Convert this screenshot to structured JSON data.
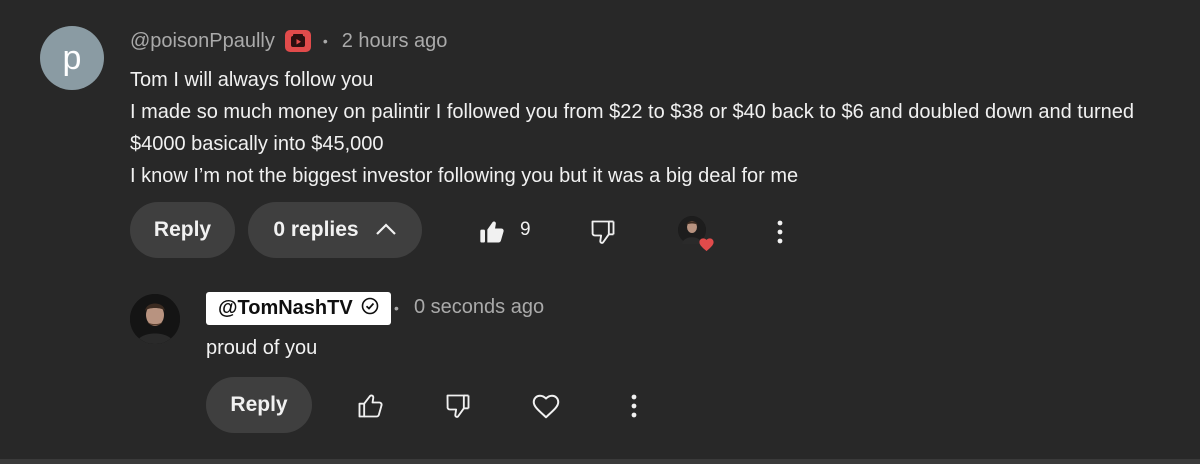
{
  "comment": {
    "avatar_letter": "p",
    "author": "@poisonPpaully",
    "separator": "•",
    "time": "2 hours ago",
    "lines": [
      "Tom I will always follow you",
      "I made so much money on palintir I followed you from $22 to $38 or $40 back to $6 and doubled down and turned",
      "$4000 basically into $45,000",
      "I know I’m not the biggest investor following you but it was a big deal for me"
    ],
    "reply_label": "Reply",
    "replies_label": "0 replies",
    "like_count": "9"
  },
  "reply": {
    "author": "@TomNashTV",
    "separator": "•",
    "time": "0 seconds ago",
    "text": "proud of you",
    "reply_label": "Reply"
  },
  "colors": {
    "background": "#282828",
    "heart": "#e14b4b",
    "member_badge": "#e14b4b"
  }
}
